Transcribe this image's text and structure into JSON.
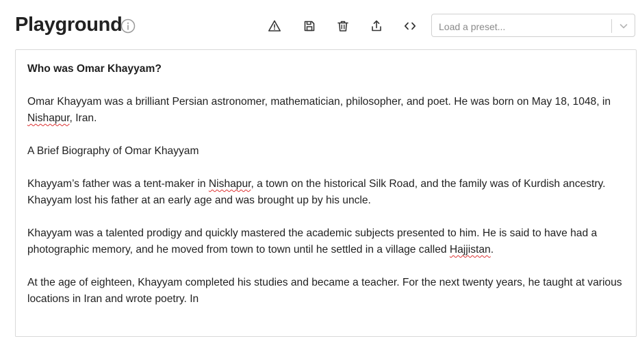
{
  "header": {
    "title": "Playground",
    "info_icon": "info-circle-icon",
    "toolbar": [
      {
        "name": "warning-button",
        "icon": "alert-triangle-icon"
      },
      {
        "name": "save-button",
        "icon": "save-icon"
      },
      {
        "name": "delete-button",
        "icon": "trash-icon"
      },
      {
        "name": "share-button",
        "icon": "share-icon"
      },
      {
        "name": "view-code-button",
        "icon": "code-icon"
      }
    ],
    "preset": {
      "placeholder": "Load a preset...",
      "chevron_icon": "chevron-down-icon"
    }
  },
  "editor": {
    "question": "Who was Omar Khayyam?",
    "p1_before": "Omar Khayyam was a brilliant Persian astronomer, mathematician, philosopher, and poet. He was born on May 18, 1048, in ",
    "p1_spell": "Nishapur",
    "p1_after": ", Iran.",
    "p2": "A Brief Biography of Omar Khayyam",
    "p3_before": "Khayyam’s father was a tent-maker in ",
    "p3_spell": "Nishapur",
    "p3_after": ", a town on the historical Silk Road, and the family was of Kurdish ancestry. Khayyam lost his father at an early age and was brought up by his uncle.",
    "p4_before": "Khayyam was a talented prodigy and quickly mastered the academic subjects presented to him. He is said to have had a photographic memory, and he moved from town to town until he settled in a village called ",
    "p4_spell": "Hajjistan",
    "p4_after": ".",
    "p5": "At the age of eighteen, Khayyam completed his studies and became a teacher. For the next twenty years, he taught at various locations in Iran and wrote poetry. In"
  },
  "colors": {
    "spellcheck_underline": "#dd3333",
    "border": "#d9d9d9",
    "icon": "#333333",
    "placeholder": "#8a8a8a"
  }
}
